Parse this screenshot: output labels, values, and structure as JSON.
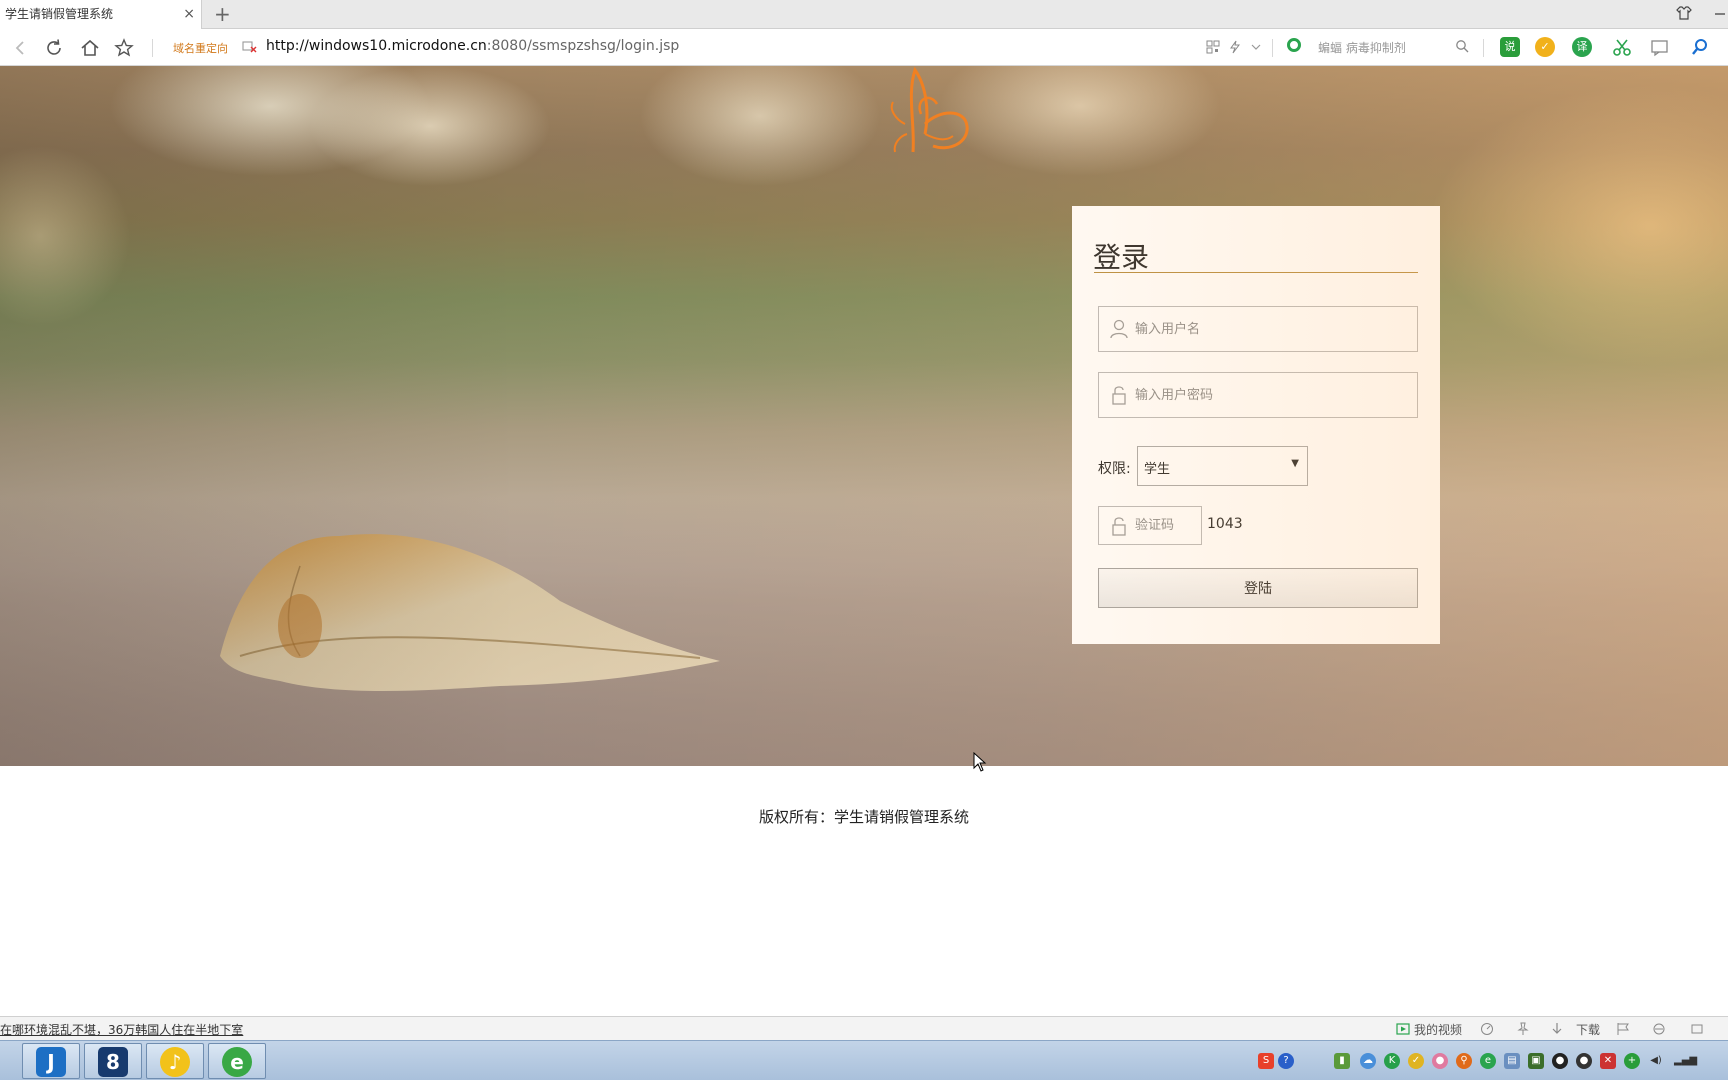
{
  "browser": {
    "tab_title": "学生请销假管理系统",
    "tab_close": "×",
    "new_tab": "+",
    "redirect_label": "域名重定向",
    "url_host": "http://windows10.microdone.cn",
    "url_rest": ":8080/ssmspzshsg/login.jsp",
    "search_placeholder": "蝙蝠 病毒抑制剂"
  },
  "login": {
    "title": "登录",
    "username_placeholder": "输入用户名",
    "password_placeholder": "输入用户密码",
    "role_label": "权限:",
    "role_value": "学生",
    "role_arrow": "▼",
    "captcha_placeholder": "验证码",
    "captcha_code": "1043",
    "submit_label": "登陆"
  },
  "footer": {
    "copyright": "版权所有：学生请销假管理系统"
  },
  "statusbar": {
    "news": "在哪环境混乱不堪，36万韩国人住在半地下室",
    "my_video": "我的视频",
    "download": "下载"
  },
  "colors": {
    "accent_rule": "#b58a3a",
    "butterfly": "#f07a18",
    "redirect": "#d2791b"
  }
}
